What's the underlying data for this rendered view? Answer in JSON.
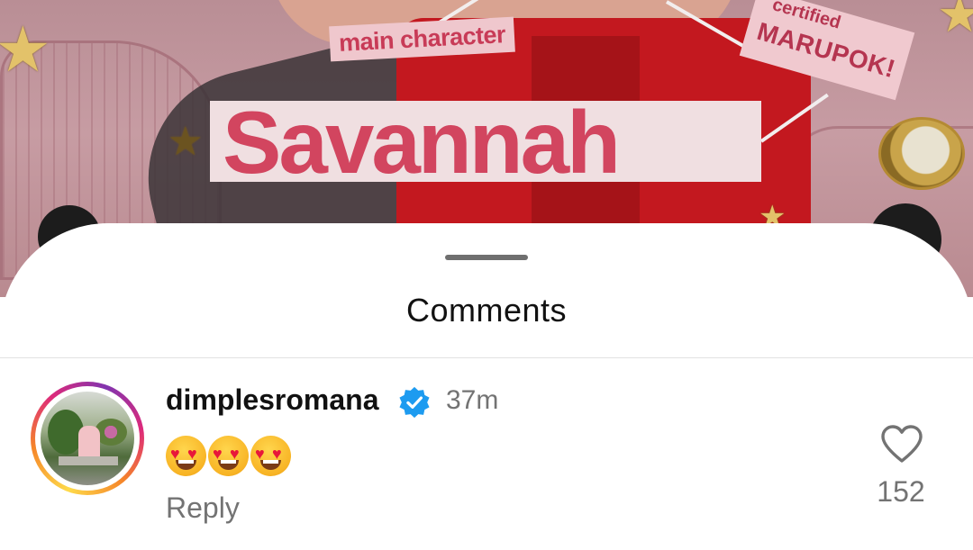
{
  "post": {
    "sticker_main": "main character",
    "sticker_certified_top": "certified",
    "sticker_certified_bottom": "MARUPOK!",
    "title": "Savannah"
  },
  "sheet": {
    "title": "Comments"
  },
  "comments": [
    {
      "username": "dimplesromana",
      "verified": true,
      "time": "37m",
      "text": "😍😍😍",
      "reply_label": "Reply",
      "like_count": "152",
      "like_icon": "heart-outline-icon"
    }
  ],
  "colors": {
    "verified_badge": "#1d9bf0",
    "secondary_text": "#737373",
    "primary_text": "#111111"
  }
}
